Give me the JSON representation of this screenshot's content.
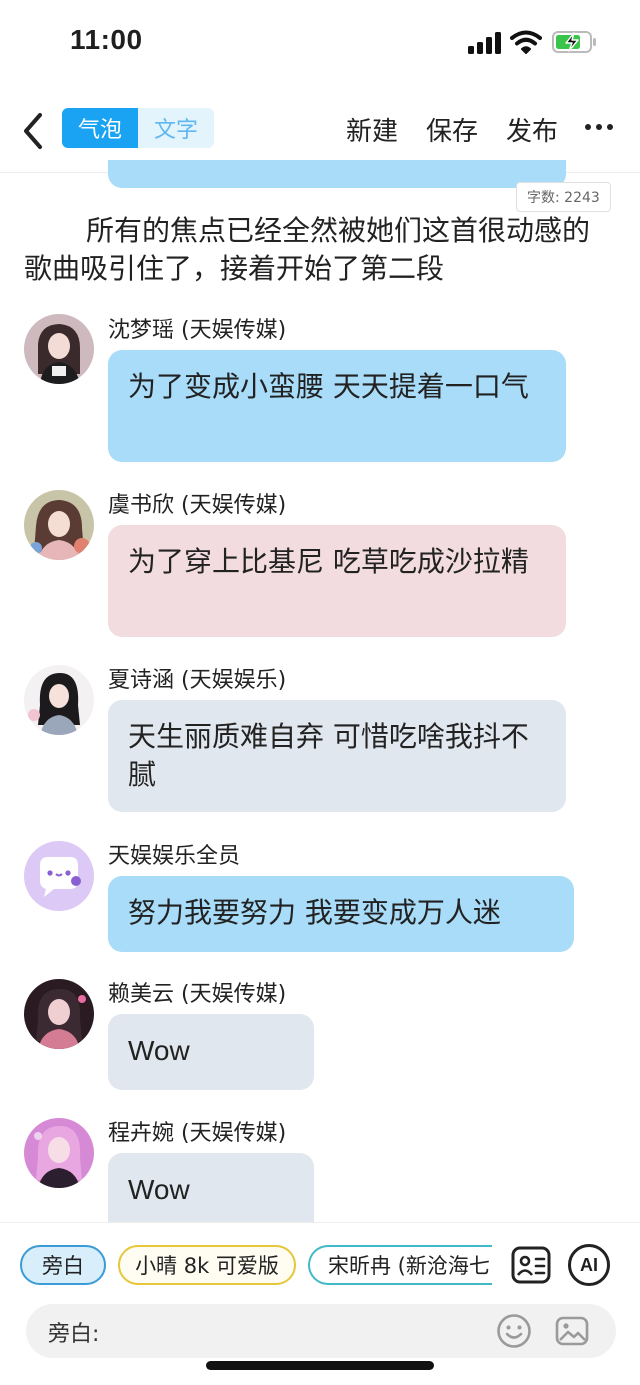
{
  "status": {
    "time": "11:00"
  },
  "toolbar": {
    "tab_bubble": "气泡",
    "tab_text": "文字",
    "new_label": "新建",
    "save_label": "保存",
    "publish_label": "发布"
  },
  "editor": {
    "word_count": "字数: 2243",
    "narration": "所有的焦点已经全然被她们这首很动感的歌曲吸引住了，接着开始了第二段"
  },
  "messages": [
    {
      "speaker": "沈梦瑶 (天娱传媒)",
      "text": "为了变成小蛮腰 天天提着一口气",
      "color": "#a8dcf9"
    },
    {
      "speaker": "虞书欣 (天娱传媒)",
      "text": "为了穿上比基尼 吃草吃成沙拉精",
      "color": "#f2dcdf"
    },
    {
      "speaker": "夏诗涵 (天娱娱乐)",
      "text": "天生丽质难自弃 可惜吃啥我抖不腻",
      "color": "#e1e7ee"
    },
    {
      "speaker": "天娱娱乐全员",
      "text": "努力我要努力 我要变成万人迷",
      "color": "#a8dcf9"
    },
    {
      "speaker": "赖美云 (天娱传媒)",
      "text": "Wow",
      "color": "#e1e7ee"
    },
    {
      "speaker": "程卉婉 (天娱传媒)",
      "text": "Wow",
      "color": "#e1e7ee"
    }
  ],
  "characters": {
    "chip_1": "旁白",
    "chip_2": "小晴 8k 可爱版",
    "chip_3": "宋昕冉 (新沧海七"
  },
  "input": {
    "label": "旁白:"
  },
  "icons": {
    "back": "chevron-left-icon",
    "more": "ellipsis-icon",
    "contact_card": "contact-card-icon",
    "ai": "ai-icon",
    "emoji": "smiley-icon",
    "image": "image-icon"
  },
  "colors": {
    "accent": "#1aa3f2",
    "bubble_blue": "#a8dcf9",
    "bubble_pink": "#f2dcdf",
    "bubble_gray": "#e1e7ee"
  },
  "ai_label": "AI"
}
